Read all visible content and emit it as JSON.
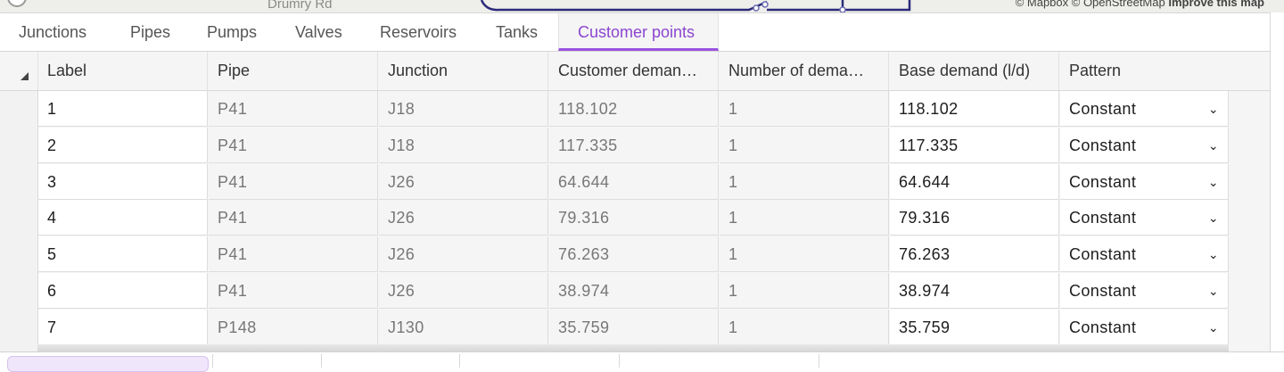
{
  "map": {
    "road_label": "Drumry Rd",
    "attribution_prefix": "© Mapbox © OpenStreetMap",
    "attribution_link": "Improve this map"
  },
  "tabs": [
    "Junctions",
    "Pipes",
    "Pumps",
    "Valves",
    "Reservoirs",
    "Tanks",
    "Customer points"
  ],
  "active_tab": "Customer points",
  "table": {
    "columns": [
      "Label",
      "Pipe",
      "Junction",
      "Customer deman…",
      "Number of dema…",
      "Base demand (l/d)",
      "Pattern"
    ],
    "rows": [
      [
        "1",
        "P41",
        "J18",
        "118.102",
        "1",
        "118.102",
        "Constant"
      ],
      [
        "2",
        "P41",
        "J18",
        "117.335",
        "1",
        "117.335",
        "Constant"
      ],
      [
        "3",
        "P41",
        "J26",
        "64.644",
        "1",
        "64.644",
        "Constant"
      ],
      [
        "4",
        "P41",
        "J26",
        "79.316",
        "1",
        "79.316",
        "Constant"
      ],
      [
        "5",
        "P41",
        "J26",
        "76.263",
        "1",
        "76.263",
        "Constant"
      ],
      [
        "6",
        "P41",
        "J26",
        "38.974",
        "1",
        "38.974",
        "Constant"
      ],
      [
        "7",
        "P148",
        "J130",
        "35.759",
        "1",
        "35.759",
        "Constant"
      ]
    ]
  },
  "colors": {
    "accent": "#8b45d0",
    "map_network": "#2a2a7a"
  }
}
